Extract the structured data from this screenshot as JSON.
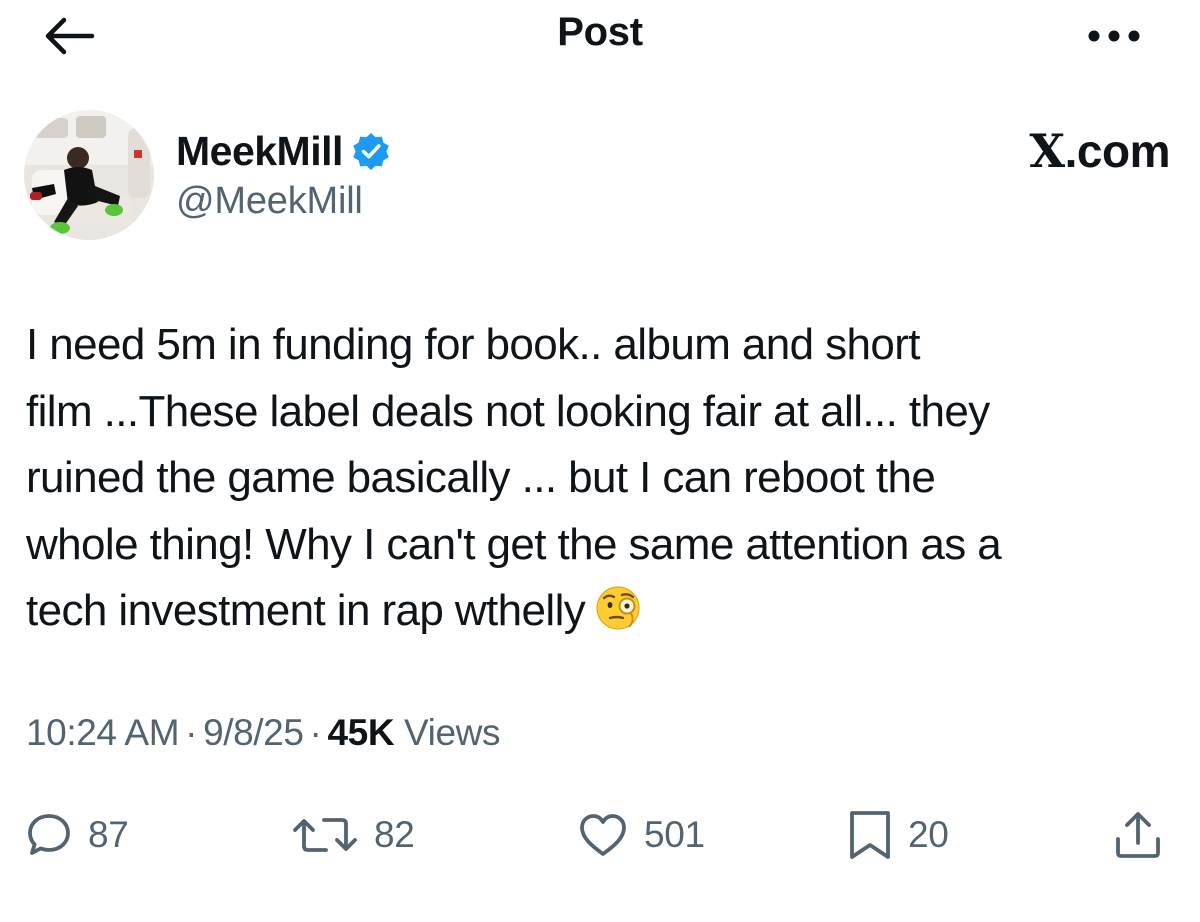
{
  "header": {
    "title": "Post",
    "back_icon": "arrow-left-icon",
    "more_icon": "more-horizontal-icon"
  },
  "author": {
    "display_name": "MeekMill",
    "handle": "@MeekMill",
    "verified": true,
    "verified_color": "#1d9bf0"
  },
  "watermark": {
    "x_letter": "X",
    "suffix": ".com"
  },
  "tweet": {
    "lines": [
      "I need 5m in funding for book.. album and short",
      "film ...These label deals not looking  fair at all... they",
      "ruined the game basically ... but I can reboot the",
      "whole thing!  Why I can't get the same attention as a",
      "tech investment in rap wthelly"
    ],
    "emoji": "face-with-monocle"
  },
  "meta": {
    "time": "10:24 AM",
    "separator": "·",
    "date": "9/8/25",
    "views_count": "45K",
    "views_label": "Views"
  },
  "actions": {
    "replies": "87",
    "reposts": "82",
    "likes": "501",
    "bookmarks": "20"
  },
  "colors": {
    "text": "#0f1419",
    "secondary": "#536471",
    "accent": "#1d9bf0"
  }
}
